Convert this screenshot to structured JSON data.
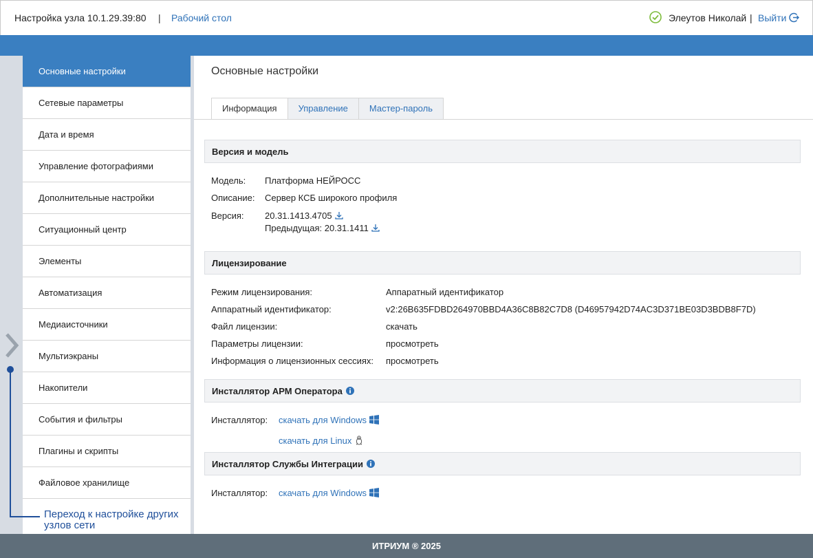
{
  "header": {
    "title": "Настройка узла 10.1.29.39:80",
    "separator": "|",
    "desktop_link": "Рабочий стол",
    "user_name": "Элеутов Николай",
    "user_separator": "|",
    "logout_label": "Выйти"
  },
  "guide_label": "Переход к настройке других узлов сети",
  "sidebar": {
    "items": [
      {
        "label": "Основные настройки",
        "active": true
      },
      {
        "label": "Сетевые параметры"
      },
      {
        "label": "Дата и время"
      },
      {
        "label": "Управление фотографиями"
      },
      {
        "label": "Дополнительные настройки"
      },
      {
        "label": "Ситуационный центр"
      },
      {
        "label": "Элементы"
      },
      {
        "label": "Автоматизация"
      },
      {
        "label": "Медиаисточники"
      },
      {
        "label": "Мультиэкраны"
      },
      {
        "label": "Накопители"
      },
      {
        "label": "События и фильтры"
      },
      {
        "label": "Плагины и скрипты"
      },
      {
        "label": "Файловое хранилище"
      }
    ]
  },
  "main": {
    "title": "Основные настройки",
    "tabs": [
      {
        "label": "Информация",
        "active": true
      },
      {
        "label": "Управление"
      },
      {
        "label": "Мастер-пароль"
      }
    ],
    "version_section": {
      "title": "Версия и модель",
      "model_label": "Модель:",
      "model_value": "Платформа НЕЙРОСС",
      "description_label": "Описание:",
      "description_value": "Сервер КСБ широкого профиля",
      "version_label": "Версия:",
      "version_value": "20.31.1413.4705",
      "previous_value": "Предыдущая: 20.31.1411"
    },
    "license_section": {
      "title": "Лицензирование",
      "mode_label": "Режим лицензирования:",
      "mode_value": "Аппаратный идентификатор",
      "hwid_label": "Аппаратный идентификатор:",
      "hwid_value": "v2:26B635FDBD264970BBD4A36C8B82C7D8 (D46957942D74AC3D371BE03D3BDB8F7D)",
      "file_label": "Файл лицензии:",
      "file_link": "скачать",
      "params_label": "Параметры лицензии:",
      "params_link": "просмотреть",
      "sessions_label": "Информация о лицензионных сессиях:",
      "sessions_link": "просмотреть"
    },
    "arm_section": {
      "title": "Инсталлятор АРМ Оператора",
      "installer_label": "Инсталлятор:",
      "windows_link": "скачать для Windows",
      "linux_link": "скачать для Linux"
    },
    "integration_section": {
      "title": "Инсталлятор Службы Интеграции",
      "installer_label": "Инсталлятор:",
      "windows_link": "скачать для Windows"
    }
  },
  "footer": {
    "text": "ИТРИУМ ® 2025"
  },
  "colors": {
    "accent": "#3a7fc1",
    "link": "#2f72b8",
    "status_ok": "#7cbb3a",
    "footer_bg": "#5f6e7a",
    "guide": "#1f4f9a"
  },
  "icons": {
    "status": "check-circle-icon",
    "logout": "logout-icon",
    "sidebar_toggle": "chevron-right-icon",
    "download": "download-icon",
    "info": "info-icon",
    "windows": "windows-icon",
    "linux": "linux-icon"
  }
}
